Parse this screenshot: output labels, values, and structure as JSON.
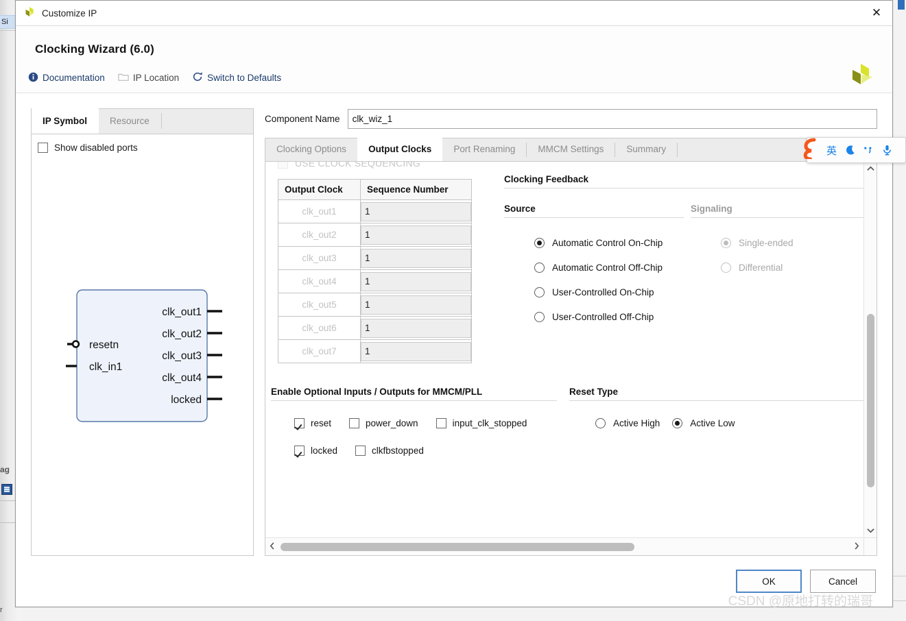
{
  "background": {
    "frag_sidebar_label": "Si",
    "frag_lower_label": "ag",
    "frag_bottom_label": "r"
  },
  "titlebar": {
    "title": "Customize IP",
    "logo_icon": "xilinx-logo-icon",
    "close_icon": "close-icon",
    "close_label": "✕"
  },
  "header": {
    "title": "Clocking Wizard (6.0)",
    "logo_icon": "xilinx-logo-icon",
    "toolbar": [
      {
        "label": "Documentation",
        "icon": "info-icon",
        "disabled": false
      },
      {
        "label": "IP Location",
        "icon": "folder-icon",
        "disabled": true
      },
      {
        "label": "Switch to Defaults",
        "icon": "refresh-icon",
        "disabled": false
      }
    ]
  },
  "left_panel": {
    "tabs": [
      {
        "label": "IP Symbol",
        "active": true
      },
      {
        "label": "Resource",
        "active": false
      }
    ],
    "show_disabled_ports": {
      "label": "Show disabled ports",
      "checked": false
    },
    "symbol": {
      "inputs": [
        {
          "name": "resetn",
          "inverted": true
        },
        {
          "name": "clk_in1",
          "inverted": false
        }
      ],
      "outputs": [
        {
          "name": "clk_out1"
        },
        {
          "name": "clk_out2"
        },
        {
          "name": "clk_out3"
        },
        {
          "name": "clk_out4"
        },
        {
          "name": "locked"
        }
      ],
      "fill_color": "#eef3fb",
      "border_color": "#5878a8"
    }
  },
  "component": {
    "label": "Component Name",
    "value": "clk_wiz_1",
    "placeholder": "clk_wiz_1"
  },
  "tabs": [
    {
      "label": "Clocking Options",
      "active": false
    },
    {
      "label": "Output Clocks",
      "active": true
    },
    {
      "label": "Port Renaming",
      "active": false
    },
    {
      "label": "MMCM Settings",
      "active": false
    },
    {
      "label": "Summary",
      "active": false
    }
  ],
  "main": {
    "use_clock_sequencing": {
      "label": "USE CLOCK SEQUENCING",
      "checked": false,
      "disabled": true
    },
    "sequence_table": {
      "headers": [
        "Output Clock",
        "Sequence Number"
      ],
      "rows": [
        {
          "clock": "clk_out1",
          "sequence": "1"
        },
        {
          "clock": "clk_out2",
          "sequence": "1"
        },
        {
          "clock": "clk_out3",
          "sequence": "1"
        },
        {
          "clock": "clk_out4",
          "sequence": "1"
        },
        {
          "clock": "clk_out5",
          "sequence": "1"
        },
        {
          "clock": "clk_out6",
          "sequence": "1"
        },
        {
          "clock": "clk_out7",
          "sequence": "1"
        }
      ]
    },
    "clocking_feedback": {
      "title": "Clocking Feedback",
      "source": {
        "title": "Source",
        "disabled": false,
        "options": [
          {
            "label": "Automatic Control On-Chip",
            "selected": true
          },
          {
            "label": "Automatic Control Off-Chip",
            "selected": false
          },
          {
            "label": "User-Controlled On-Chip",
            "selected": false
          },
          {
            "label": "User-Controlled Off-Chip",
            "selected": false
          }
        ]
      },
      "signaling": {
        "title": "Signaling",
        "disabled": true,
        "options": [
          {
            "label": "Single-ended",
            "selected": true
          },
          {
            "label": "Differential",
            "selected": false
          }
        ]
      }
    },
    "optional_io": {
      "title": "Enable Optional Inputs / Outputs for MMCM/PLL",
      "row1": [
        {
          "label": "reset",
          "checked": true
        },
        {
          "label": "power_down",
          "checked": false
        },
        {
          "label": "input_clk_stopped",
          "checked": false
        }
      ],
      "row2": [
        {
          "label": "locked",
          "checked": true
        },
        {
          "label": "clkfbstopped",
          "checked": false
        }
      ]
    },
    "reset_type": {
      "title": "Reset Type",
      "options": [
        {
          "label": "Active High",
          "selected": false
        },
        {
          "label": "Active Low",
          "selected": true
        }
      ]
    },
    "scrollbars": {
      "vertical": {
        "up_icon": "chevron-up-icon",
        "down_icon": "chevron-down-icon"
      },
      "horizontal": {
        "left_icon": "chevron-left-icon",
        "right_icon": "chevron-right-icon"
      }
    }
  },
  "footer": {
    "ok_label": "OK",
    "cancel_label": "Cancel",
    "watermark": "CSDN @原地打转的瑞哥"
  },
  "ime": {
    "logo_icon": "sogou-logo-icon",
    "buttons": [
      {
        "icon": "language-mode-icon",
        "label": "英"
      },
      {
        "icon": "moon-icon",
        "label": "☽"
      },
      {
        "icon": "punctuation-icon",
        "label": "⁙"
      },
      {
        "icon": "microphone-icon",
        "label": "Ἲ4"
      }
    ]
  },
  "colors": {
    "accent_blue": "#1b3a6b",
    "focus_blue": "#4f86c6",
    "logo_green": "#c8d322",
    "logo_olive": "#8f9417",
    "ime_blue": "#1a84e8",
    "ime_orange": "#f4581c"
  }
}
